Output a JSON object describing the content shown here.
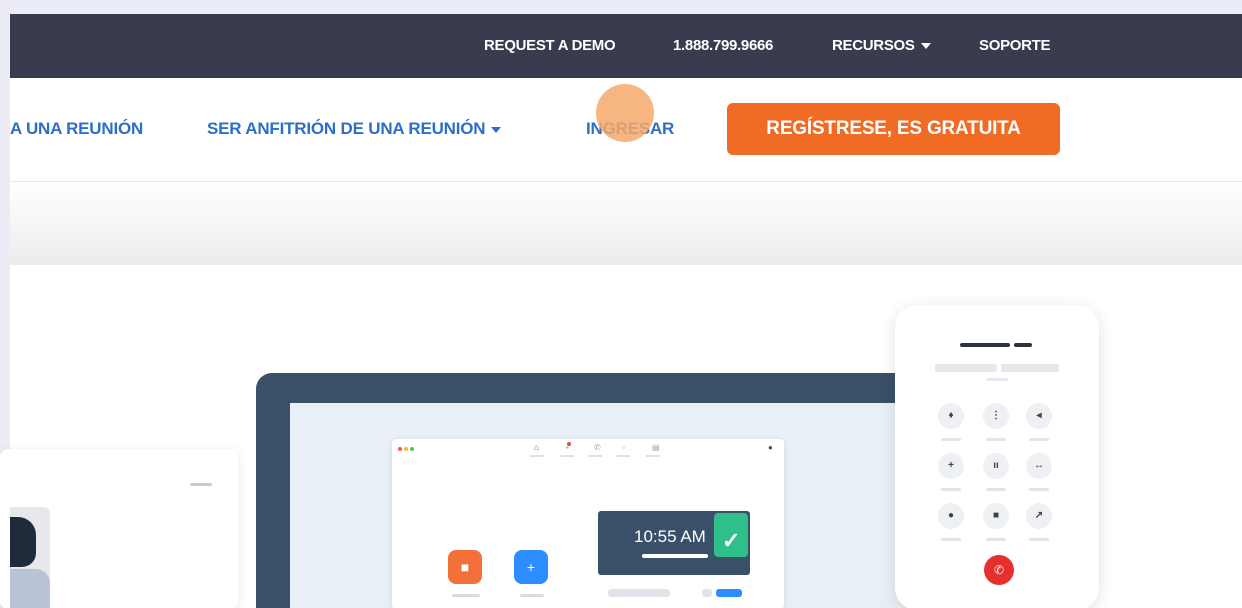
{
  "topbar": {
    "request_demo": "REQUEST A DEMO",
    "phone": "1.888.799.9666",
    "resources": "RECURSOS",
    "support": "SOPORTE"
  },
  "nav": {
    "join": "A UNA REUNIÓN",
    "host": "SER ANFITRIÓN DE UNA REUNIÓN",
    "signin": "INGRESAR",
    "signup": "REGÍSTRESE, ES GRATUITA"
  },
  "illustration": {
    "clock_time": "10:55 AM"
  },
  "colors": {
    "topbar_bg": "#393b4e",
    "link_blue": "#2d6ec7",
    "signup_orange": "#f06b23",
    "laptop_frame": "#3a5068",
    "accent_green": "#2fbf8b",
    "hangup_red": "#e6302f"
  },
  "icons": [
    "caret-down-icon",
    "home-icon",
    "chat-icon",
    "phone-icon",
    "meetings-icon",
    "contacts-icon",
    "video-camera-icon",
    "plus-icon",
    "microphone-icon",
    "keypad-icon",
    "speaker-icon",
    "add-call-icon",
    "pause-icon",
    "merge-icon",
    "record-icon",
    "video-icon",
    "transfer-icon",
    "hang-up-icon"
  ]
}
